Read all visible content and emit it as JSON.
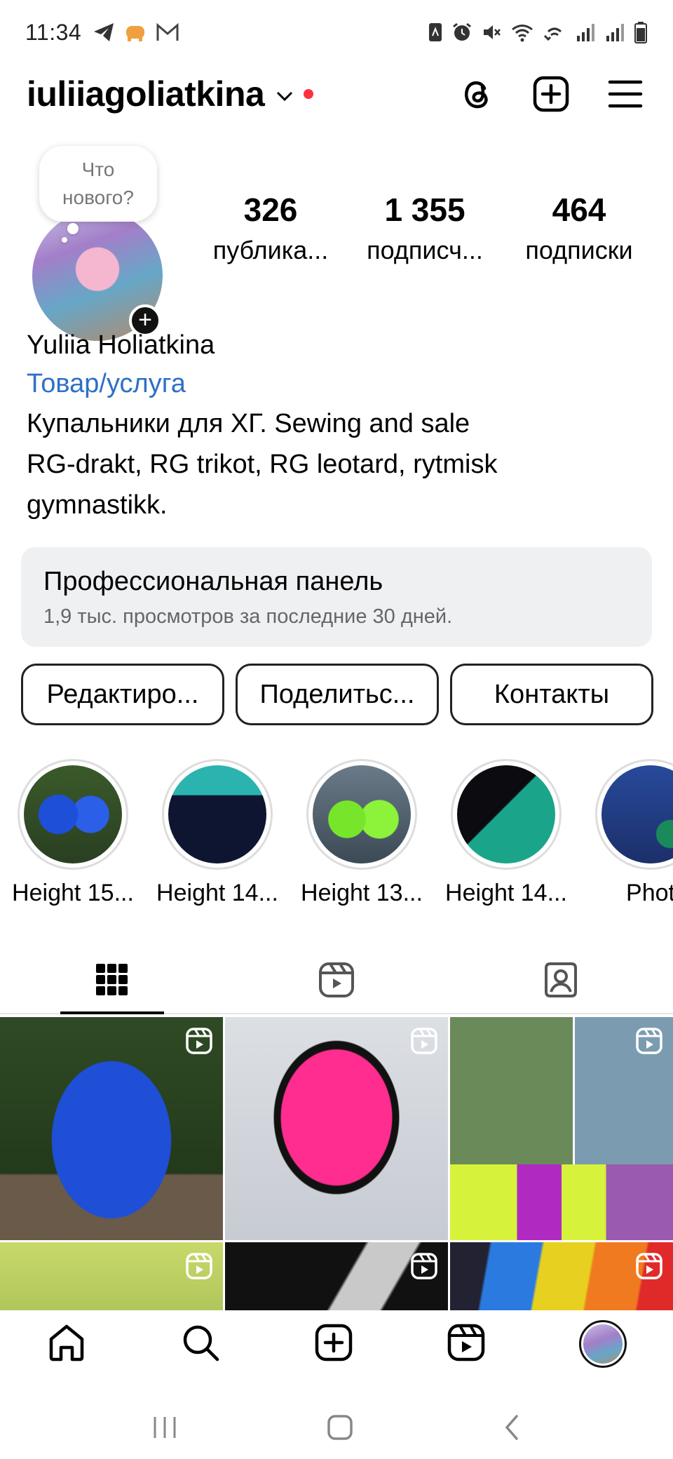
{
  "status_bar": {
    "time": "11:34",
    "left_icons": [
      "telegram-icon",
      "elephant-icon",
      "gmail-icon"
    ],
    "right_icons": [
      "nfc-icon",
      "alarm-icon",
      "mute-icon",
      "wifi-icon",
      "wifi-calling-icon",
      "signal-icon",
      "signal-icon",
      "battery-icon"
    ]
  },
  "header": {
    "username": "iuliiagoliatkina"
  },
  "note": {
    "text_line1": "Что",
    "text_line2": "нового?"
  },
  "stats": [
    {
      "value": "326",
      "label": "публика..."
    },
    {
      "value": "1 355",
      "label": "подписч..."
    },
    {
      "value": "464",
      "label": "подписки"
    }
  ],
  "bio": {
    "name": "Yuliia Holiatkina",
    "category": "Товар/услуга",
    "line1": "Купальники для ХГ.  Sewing and sale",
    "line2": "RG-drakt, RG trikot, RG leotard, rytmisk",
    "line3": "gymnastikk."
  },
  "pro_panel": {
    "title": "Профессиональная панель",
    "subtitle": "1,9 тыс. просмотров за последние 30 дней."
  },
  "buttons": {
    "edit": "Редактиро...",
    "share": "Поделитьс...",
    "contacts": "Контакты"
  },
  "highlights": [
    {
      "label": "Height 15..."
    },
    {
      "label": "Height 14..."
    },
    {
      "label": "Height 13..."
    },
    {
      "label": "Height 14..."
    },
    {
      "label": "Phot"
    }
  ],
  "colors": {
    "link_blue": "#2e70c7",
    "notification_red": "#ff3040",
    "panel_bg": "#eff0f2"
  }
}
